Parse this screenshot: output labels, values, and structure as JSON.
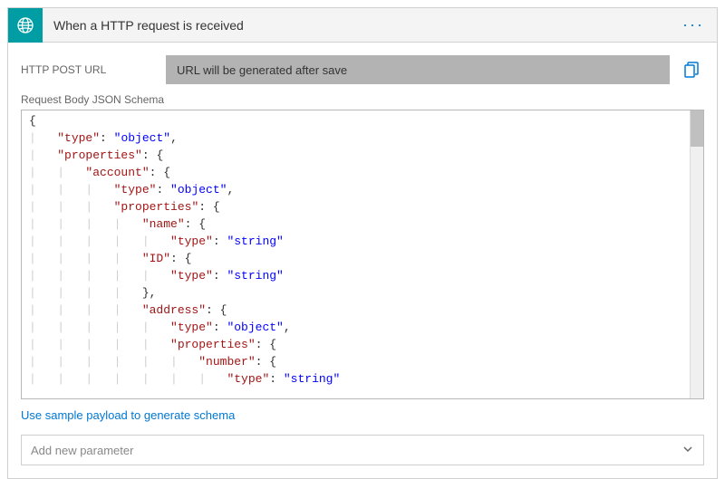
{
  "header": {
    "title": "When a HTTP request is received",
    "icon": "globe-icon"
  },
  "post_url": {
    "label": "HTTP POST URL",
    "value": "URL will be generated after save"
  },
  "schema_label": "Request Body JSON Schema",
  "schema": {
    "lines": [
      {
        "indent": 0,
        "parts": [
          {
            "t": "brace",
            "v": "{"
          }
        ]
      },
      {
        "indent": 1,
        "parts": [
          {
            "t": "key",
            "v": "\"type\""
          },
          {
            "t": "colon",
            "v": ": "
          },
          {
            "t": "str",
            "v": "\"object\""
          },
          {
            "t": "brace",
            "v": ","
          }
        ]
      },
      {
        "indent": 1,
        "parts": [
          {
            "t": "key",
            "v": "\"properties\""
          },
          {
            "t": "colon",
            "v": ": "
          },
          {
            "t": "brace",
            "v": "{"
          }
        ]
      },
      {
        "indent": 2,
        "parts": [
          {
            "t": "key",
            "v": "\"account\""
          },
          {
            "t": "colon",
            "v": ": "
          },
          {
            "t": "brace",
            "v": "{"
          }
        ]
      },
      {
        "indent": 3,
        "parts": [
          {
            "t": "key",
            "v": "\"type\""
          },
          {
            "t": "colon",
            "v": ": "
          },
          {
            "t": "str",
            "v": "\"object\""
          },
          {
            "t": "brace",
            "v": ","
          }
        ]
      },
      {
        "indent": 3,
        "parts": [
          {
            "t": "key",
            "v": "\"properties\""
          },
          {
            "t": "colon",
            "v": ": "
          },
          {
            "t": "brace",
            "v": "{"
          }
        ]
      },
      {
        "indent": 4,
        "parts": [
          {
            "t": "key",
            "v": "\"name\""
          },
          {
            "t": "colon",
            "v": ": "
          },
          {
            "t": "brace",
            "v": "{"
          }
        ]
      },
      {
        "indent": 5,
        "parts": [
          {
            "t": "key",
            "v": "\"type\""
          },
          {
            "t": "colon",
            "v": ": "
          },
          {
            "t": "str",
            "v": "\"string\""
          }
        ]
      },
      {
        "indent": 4,
        "parts": [
          {
            "t": "key",
            "v": "\"ID\""
          },
          {
            "t": "colon",
            "v": ": "
          },
          {
            "t": "brace",
            "v": "{"
          }
        ]
      },
      {
        "indent": 5,
        "parts": [
          {
            "t": "key",
            "v": "\"type\""
          },
          {
            "t": "colon",
            "v": ": "
          },
          {
            "t": "str",
            "v": "\"string\""
          }
        ]
      },
      {
        "indent": 4,
        "parts": [
          {
            "t": "brace",
            "v": "},"
          }
        ]
      },
      {
        "indent": 4,
        "parts": [
          {
            "t": "key",
            "v": "\"address\""
          },
          {
            "t": "colon",
            "v": ": "
          },
          {
            "t": "brace",
            "v": "{"
          }
        ]
      },
      {
        "indent": 5,
        "parts": [
          {
            "t": "key",
            "v": "\"type\""
          },
          {
            "t": "colon",
            "v": ": "
          },
          {
            "t": "str",
            "v": "\"object\""
          },
          {
            "t": "brace",
            "v": ","
          }
        ]
      },
      {
        "indent": 5,
        "parts": [
          {
            "t": "key",
            "v": "\"properties\""
          },
          {
            "t": "colon",
            "v": ": "
          },
          {
            "t": "brace",
            "v": "{"
          }
        ]
      },
      {
        "indent": 6,
        "parts": [
          {
            "t": "key",
            "v": "\"number\""
          },
          {
            "t": "colon",
            "v": ": "
          },
          {
            "t": "brace",
            "v": "{"
          }
        ]
      },
      {
        "indent": 7,
        "parts": [
          {
            "t": "key",
            "v": "\"type\""
          },
          {
            "t": "colon",
            "v": ": "
          },
          {
            "t": "str",
            "v": "\"string\""
          }
        ]
      }
    ]
  },
  "sample_link": "Use sample payload to generate schema",
  "param_select": {
    "placeholder": "Add new parameter"
  }
}
